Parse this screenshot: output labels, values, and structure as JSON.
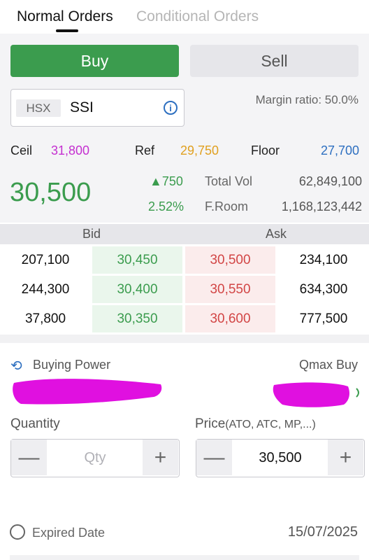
{
  "tabs": {
    "normal": "Normal Orders",
    "conditional": "Conditional Orders"
  },
  "side": {
    "buy": "Buy",
    "sell": "Sell"
  },
  "symbol": {
    "exchange": "HSX",
    "code": "SSI"
  },
  "margin": {
    "label": "Margin ratio:",
    "value": "50.0%"
  },
  "prices": {
    "ceil_label": "Ceil",
    "ceil": "31,800",
    "ref_label": "Ref",
    "ref": "29,750",
    "floor_label": "Floor",
    "floor": "27,700"
  },
  "quote": {
    "last": "30,500",
    "change": "▲750",
    "change_pct": "2.52%",
    "total_vol_label": "Total Vol",
    "total_vol": "62,849,100",
    "froom_label": "F.Room",
    "froom": "1,168,123,442"
  },
  "orderbook": {
    "bid_header": "Bid",
    "ask_header": "Ask",
    "rows": [
      {
        "bid_vol": "207,100",
        "bid_price": "30,450",
        "ask_price": "30,500",
        "ask_vol": "234,100"
      },
      {
        "bid_vol": "244,300",
        "bid_price": "30,400",
        "ask_price": "30,550",
        "ask_vol": "634,300"
      },
      {
        "bid_vol": "37,800",
        "bid_price": "30,350",
        "ask_price": "30,600",
        "ask_vol": "777,500"
      }
    ]
  },
  "buying_power": {
    "label": "Buying Power",
    "qmax_label": "Qmax Buy"
  },
  "quantity": {
    "label": "Quantity",
    "placeholder": "Qty",
    "minus": "—",
    "plus": "+"
  },
  "price": {
    "label": "Price",
    "sub": "(ATO, ATC, MP,...)",
    "value": "30,500",
    "minus": "—",
    "plus": "+"
  },
  "expiry": {
    "label": "Expired Date",
    "date": "15/07/2025"
  },
  "colors": {
    "ceil": "#c42fd0",
    "ref": "#e0a020",
    "floor": "#2d6fc0",
    "up": "#3b9c4e",
    "down": "#d24545",
    "redaction": "#e010e0"
  }
}
